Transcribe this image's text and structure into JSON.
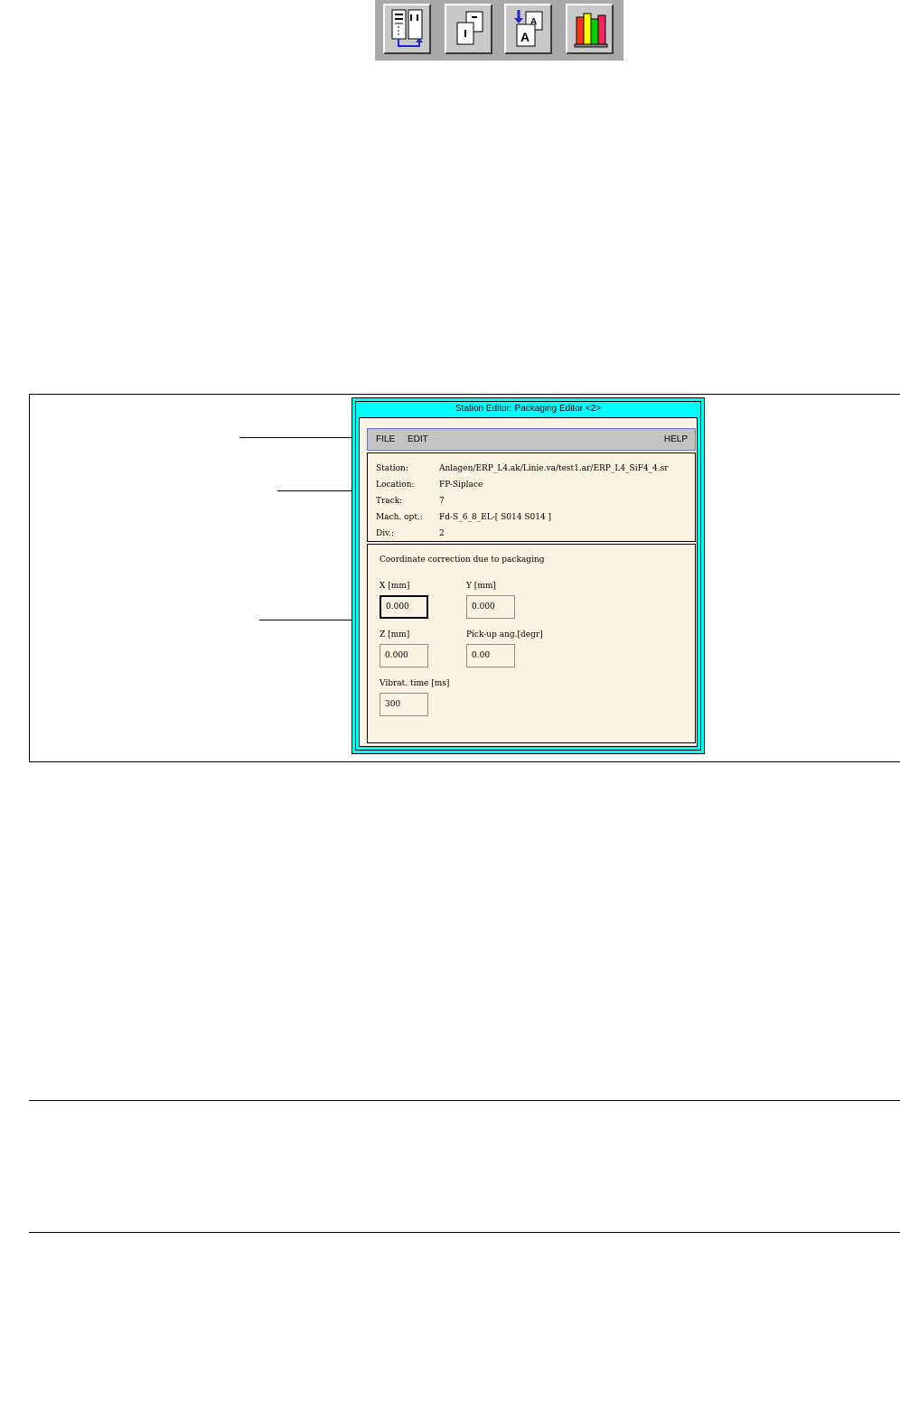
{
  "toolbar": {
    "buttons": [
      {
        "icon": "station-list-icon"
      },
      {
        "icon": "pages-icon"
      },
      {
        "icon": "package-text-icon"
      },
      {
        "icon": "library-books-icon"
      }
    ]
  },
  "window": {
    "title": "Station Editor: Packaging Editor <2>",
    "menu": {
      "file": "FILE",
      "edit": "EDIT",
      "help": "HELP"
    },
    "info": [
      {
        "label": "Station:",
        "value": "Anlagen/ERP_L4.ak/Linie.va/test1.ar/ERP_L4_SiF4_4.sr"
      },
      {
        "label": "Location:",
        "value": "FP-Siplace"
      },
      {
        "label": "Track:",
        "value": "7"
      },
      {
        "label": "Mach. opt.:",
        "value": "Fd-S_6_8_EL-[ S014 S014 ]"
      },
      {
        "label": "Div.:",
        "value": "2"
      }
    ],
    "correction": {
      "title": "Coordinate correction due to packaging",
      "x_label": "X [mm]",
      "x_value": "0.000",
      "y_label": "Y [mm]",
      "y_value": "0.000",
      "z_label": "Z [mm]",
      "z_value": "0.000",
      "pick_label": "Pick-up ang.[degr]",
      "pick_value": "0.00",
      "vib_label": "Vibrat. time [ms]",
      "vib_value": "300"
    }
  }
}
